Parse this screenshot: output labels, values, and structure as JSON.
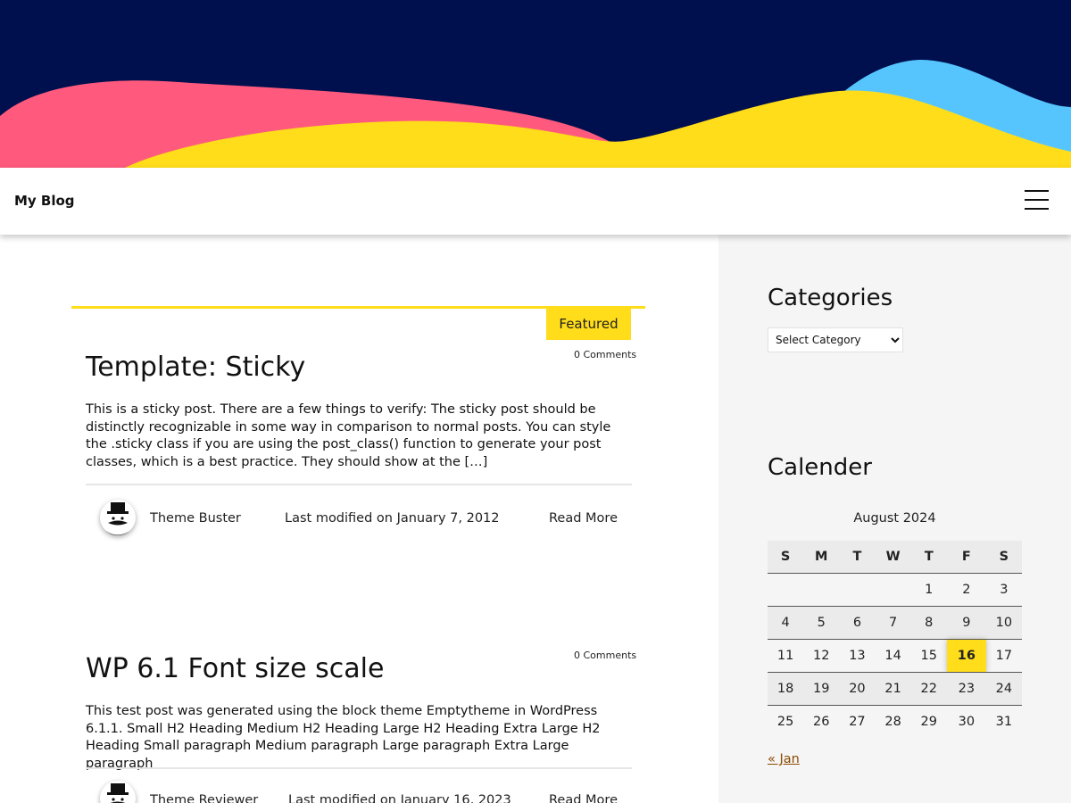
{
  "site": {
    "title": "My Blog"
  },
  "colors": {
    "hero_background": "#000f4d",
    "wave_pink": "#ff5a7d",
    "wave_yellow": "#ffdd1a",
    "wave_blue": "#56c5fd",
    "accent": "#ffdd1a",
    "sidebar_background": "#f5f5f5",
    "link_brown": "#8a4a00"
  },
  "header": {
    "menu_icon": "hamburger-icon"
  },
  "posts": [
    {
      "badge": "Featured",
      "comments": "0 Comments",
      "title": "Template: Sticky",
      "excerpt": "This is a sticky post. There are a few things to verify: The sticky post should be distinctly recognizable in some way in comparison to normal posts. You can style the .sticky class if you are using the post_class() function to generate your post classes, which is a best practice. They should show at the […]",
      "author": "Theme Buster",
      "modified": "Last modified on January 7, 2012",
      "read_more": "Read More",
      "avatar_icon": "hat-mustache-avatar-icon"
    },
    {
      "comments": "0 Comments",
      "title": "WP 6.1 Font size scale",
      "excerpt": "This test post was generated using the block theme Emptytheme in WordPress 6.1.1. Small H2 Heading Medium H2 Heading Large H2 Heading Extra Large H2 Heading Small paragraph Medium paragraph Large paragraph Extra Large paragraph",
      "author": "Theme Reviewer",
      "modified": "Last modified on January 16, 2023",
      "read_more": "Read More",
      "avatar_icon": "hat-mustache-avatar-icon"
    }
  ],
  "sidebar": {
    "categories_title": "Categories",
    "category_select": {
      "selected": "Select Category"
    },
    "calendar_title": "Calender",
    "calendar": {
      "caption": "August 2024",
      "weekdays": [
        "S",
        "M",
        "T",
        "W",
        "T",
        "F",
        "S"
      ],
      "weeks": [
        [
          "",
          "",
          "",
          "",
          "1",
          "2",
          "3"
        ],
        [
          "4",
          "5",
          "6",
          "7",
          "8",
          "9",
          "10"
        ],
        [
          "11",
          "12",
          "13",
          "14",
          "15",
          "16",
          "17"
        ],
        [
          "18",
          "19",
          "20",
          "21",
          "22",
          "23",
          "24"
        ],
        [
          "25",
          "26",
          "27",
          "28",
          "29",
          "30",
          "31"
        ]
      ],
      "today": "16",
      "prev_link": "« Jan"
    }
  }
}
